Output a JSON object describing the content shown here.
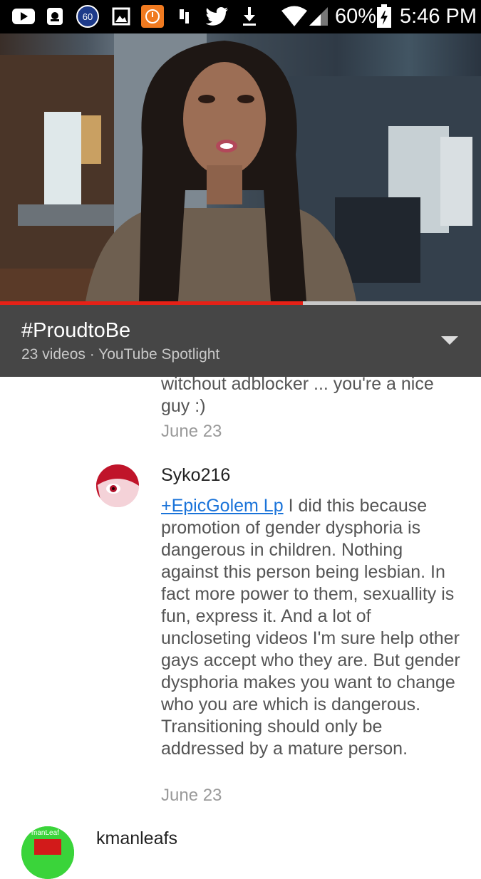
{
  "status_bar": {
    "notification_count": "60",
    "battery": "60%",
    "time": "5:46 PM",
    "icons": [
      "youtube-icon",
      "screenshot-icon",
      "counter-badge-icon",
      "gallery-icon",
      "app-icon",
      "tool-icon",
      "twitter-icon",
      "download-icon",
      "wifi-icon",
      "signal-icon",
      "battery-icon"
    ]
  },
  "video": {
    "progress": 0.63
  },
  "playlist": {
    "title": "#ProudtoBe",
    "subtitle": "23 videos · YouTube Spotlight"
  },
  "comments": {
    "prev_reply": {
      "text": "witchout adblocker ... you're a nice guy :)",
      "date": "June 23"
    },
    "reply": {
      "author": "Syko216",
      "mention": "+EpicGolem Lp",
      "text": " I did this because promotion of gender dysphoria is dangerous in children. Nothing against this person being lesbian. In fact more power to them, sexuallity is fun, express it. And a lot of uncloseting videos I'm sure help other gays accept who they are. But gender dysphoria makes you want to change who you are which is dangerous. Transitioning should only be addressed by a mature person.",
      "date": "June 23"
    },
    "next": {
      "author": "kmanleafs",
      "avatar_text": "manLeaf"
    }
  },
  "colors": {
    "accent": "#e62117",
    "link": "#1a73d9",
    "playlist_bg": "#464646"
  }
}
